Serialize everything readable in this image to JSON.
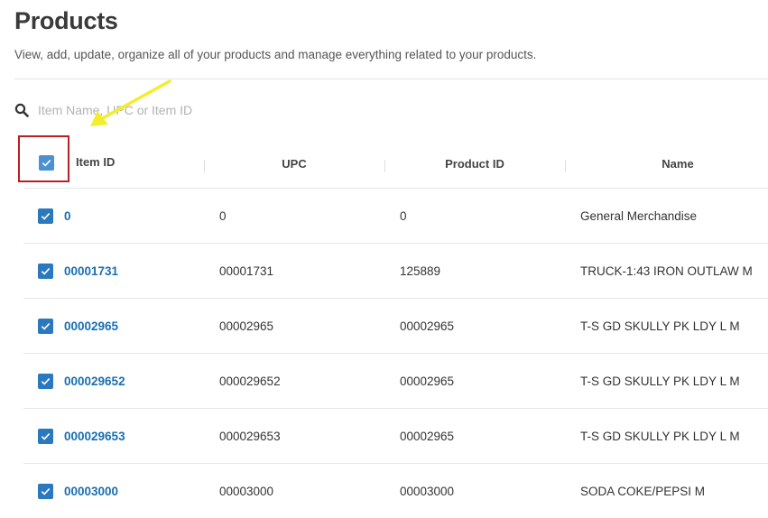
{
  "header": {
    "title": "Products",
    "subtitle": "View, add, update, organize all of your products and manage everything related to your products."
  },
  "search": {
    "placeholder": "Item Name, UPC or Item ID",
    "value": ""
  },
  "table": {
    "columns": [
      "Item ID",
      "UPC",
      "Product ID",
      "Name"
    ],
    "rows": [
      {
        "item_id": "0",
        "upc": "0",
        "product_id": "0",
        "name": "General Merchandise"
      },
      {
        "item_id": "00001731",
        "upc": "00001731",
        "product_id": "125889",
        "name": "TRUCK-1:43 IRON OUTLAW M"
      },
      {
        "item_id": "00002965",
        "upc": "00002965",
        "product_id": "00002965",
        "name": "T-S GD SKULLY PK LDY L M"
      },
      {
        "item_id": "000029652",
        "upc": "000029652",
        "product_id": "00002965",
        "name": "T-S GD SKULLY PK LDY L M"
      },
      {
        "item_id": "000029653",
        "upc": "000029653",
        "product_id": "00002965",
        "name": "T-S GD SKULLY PK LDY L M"
      },
      {
        "item_id": "00003000",
        "upc": "00003000",
        "product_id": "00003000",
        "name": "SODA COKE/PEPSI M"
      }
    ]
  },
  "icons": {
    "search": "search-icon",
    "checkbox": "checkmark-icon",
    "annotation": "arrow-icon"
  },
  "colors": {
    "link": "#1a6fb0",
    "checkbox": "#2a78bd",
    "highlight_border": "#b82025",
    "annotation_arrow": "#f2ee2b"
  }
}
